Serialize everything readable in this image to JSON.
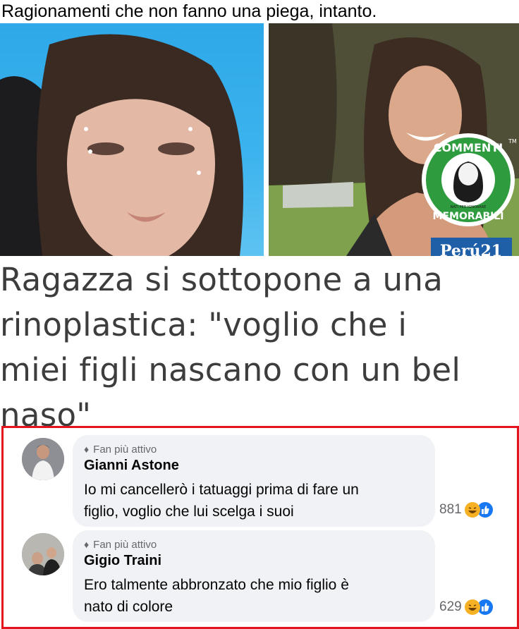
{
  "caption": "Ragionamenti che non fanno una piega, intanto.",
  "article": {
    "headline_lines": [
      "Ragazza si sottopone a una",
      "rinoplastica: \"voglio che i",
      "miei figli nascano con un bel",
      "naso\""
    ],
    "source_badge": "Perú21",
    "watermark": {
      "top": "COMMENTI",
      "bottom": "MEMORABILI",
      "small": "NATI PER IGNORARE",
      "tm": "TM"
    }
  },
  "comments": [
    {
      "badge": "Fan più attivo",
      "author": "Gianni Astone",
      "text_lines": [
        "Io mi cancellerò i tatuaggi prima di fare un",
        "figlio, voglio che lui scelga i suoi"
      ],
      "reaction_count": "881",
      "reaction_icons": [
        "haha-icon",
        "like-icon"
      ]
    },
    {
      "badge": "Fan più attivo",
      "author": "Gigio Traini",
      "text_lines": [
        "Ero talmente abbronzato che mio figlio è",
        "nato di colore"
      ],
      "reaction_count": "629",
      "reaction_icons": [
        "haha-icon",
        "like-icon"
      ]
    }
  ],
  "colors": {
    "highlight_border": "#e3141e",
    "bubble": "#f0f2f5",
    "like_blue": "#1877f2",
    "haha_yellow": "#f7b125"
  }
}
